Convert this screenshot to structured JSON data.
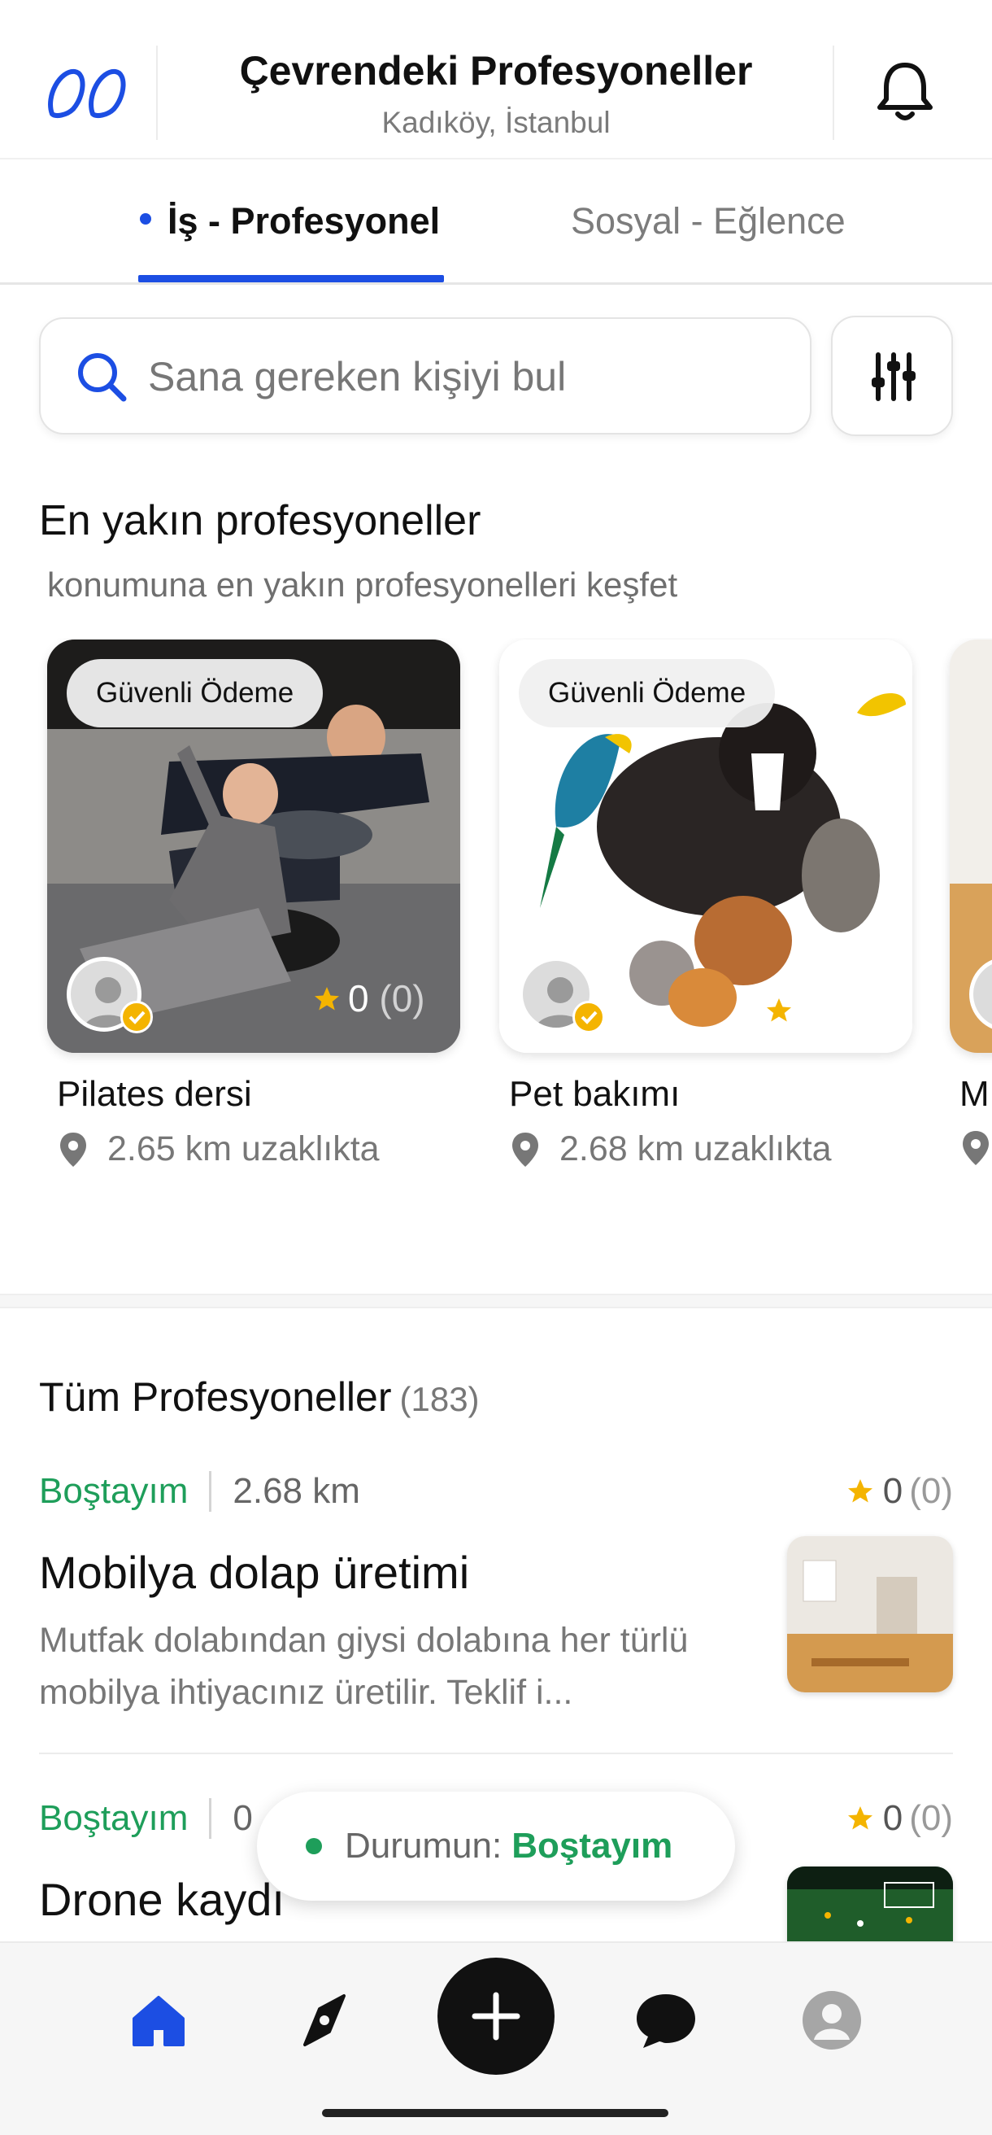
{
  "header": {
    "title": "Çevrendeki Profesyoneller",
    "location": "Kadıköy, İstanbul"
  },
  "tabs": [
    {
      "label": "İş - Profesyonel",
      "active": true
    },
    {
      "label": "Sosyal - Eğlence",
      "active": false
    }
  ],
  "search": {
    "placeholder": "Sana gereken kişiyi bul"
  },
  "nearest": {
    "title": "En yakın profesyoneller",
    "subtitle": " konumuna en yakın profesyonelleri keşfet",
    "cards": [
      {
        "badge": "Güvenli Ödeme",
        "title": "Pilates dersi",
        "distance": "2.65 km uzaklıkta",
        "rating": "0",
        "rating_count": "(0)"
      },
      {
        "badge": "Güvenli Ödeme",
        "title": "Pet bakımı",
        "distance": "2.68 km uzaklıkta",
        "rating": "",
        "rating_count": ""
      },
      {
        "badge": "",
        "title": "M",
        "distance": "",
        "rating": "",
        "rating_count": ""
      }
    ]
  },
  "all": {
    "title": "Tüm Profesyoneller",
    "count": "(183)",
    "items": [
      {
        "status": "Boştayım",
        "distance": "2.68 km",
        "rating": "0",
        "rating_count": "(0)",
        "title": "Mobilya dolap üretimi",
        "description": "Mutfak dolabından giysi dolabına her türlü mobilya ihtiyacınız  üretilir. Teklif i..."
      },
      {
        "status": "Boştayım",
        "distance": "0",
        "rating": "0",
        "rating_count": "(0)",
        "title": "Drone kaydı",
        "description": ""
      }
    ]
  },
  "status_toast": {
    "label": "Durumun:",
    "value": "Boştayım"
  },
  "colors": {
    "accent": "#1c4ee3",
    "available": "#1e9e5a",
    "star": "#f4b400"
  },
  "nav": {
    "items": [
      "home-icon",
      "compass-icon",
      "add-icon",
      "chat-icon",
      "profile-icon"
    ],
    "active": "home-icon"
  }
}
